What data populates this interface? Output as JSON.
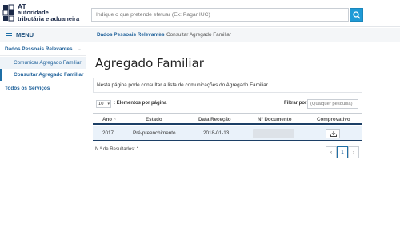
{
  "header": {
    "logo": {
      "at": "AT",
      "line1": "autoridade",
      "line2": "tributária e aduaneira"
    },
    "search": {
      "placeholder": "Indique o que pretende efetuar (Ex: Pagar IUC)",
      "icon": "search-icon"
    }
  },
  "sidebar": {
    "menu_label": "MENU",
    "group_label": "Dados Pessoais Relevantes",
    "items": [
      {
        "label": "Comunicar Agregado Familiar"
      },
      {
        "label": "Consultar Agregado Familiar"
      }
    ],
    "all_services": "Todos os Serviços"
  },
  "breadcrumb": {
    "parent": "Dados Pessoais Relevantes",
    "separator": "›",
    "current": "Consultar Agregado Familiar"
  },
  "main": {
    "title": "Agregado Familiar",
    "info": "Nesta página pode consultar a lista de comunicações do Agregado Familiar.",
    "page_size": "10",
    "page_size_label": ": Elementos por página",
    "filter_label": "Filtrar por:",
    "filter_placeholder": "(Qualquer pesquisa)",
    "table": {
      "headers": [
        "Ano",
        "Estado",
        "Data Receção",
        "Nº Documento",
        "Comprovativo"
      ],
      "sort_indicator": "^",
      "rows": [
        {
          "ano": "2017",
          "estado": "Pré-preenchimento",
          "data": "2018-01-13",
          "documento": "",
          "comprovativo": "download-icon"
        }
      ]
    },
    "results_label": "N.º de Resultados:",
    "results_count": "1",
    "pagination": {
      "prev": "‹",
      "current": "1",
      "next": "›"
    }
  },
  "colors": {
    "accent": "#1f9ad6",
    "nav_text": "#1c5f99",
    "table_header_border": "#1c3f66",
    "row_highlight": "#eaf2fa"
  }
}
